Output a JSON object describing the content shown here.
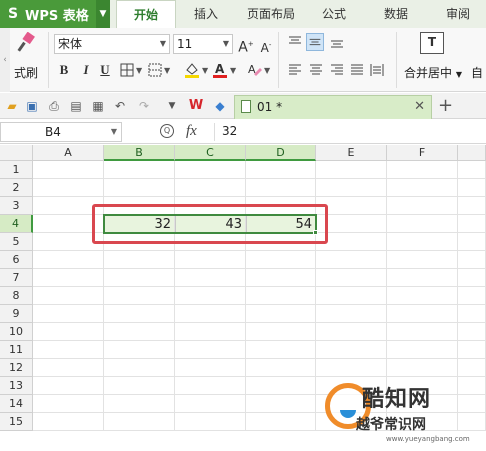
{
  "app": {
    "name": "WPS 表格"
  },
  "menu_tabs": [
    "开始",
    "插入",
    "页面布局",
    "公式",
    "数据",
    "审阅"
  ],
  "ribbon": {
    "format_painter_label": "式刷",
    "font_name": "宋体",
    "font_size": "11",
    "grow_font": "A",
    "shrink_font": "A",
    "bold": "B",
    "italic": "I",
    "underline": "U",
    "merge_center_label": "合并居中",
    "auto_label": "自"
  },
  "document": {
    "tab_name": "01 *"
  },
  "formula_bar": {
    "cell_ref": "B4",
    "fx_label": "fx",
    "value": "32"
  },
  "sheet": {
    "columns": [
      "A",
      "B",
      "C",
      "D",
      "E",
      "F"
    ],
    "rows": [
      "1",
      "2",
      "3",
      "4",
      "5",
      "6",
      "7",
      "8",
      "9",
      "10",
      "11",
      "12",
      "13",
      "14",
      "15"
    ],
    "cells": {
      "B4": "32",
      "C4": "43",
      "D4": "54"
    },
    "selected_range": "B4:D4"
  },
  "watermark": {
    "title": "酷知网",
    "subtitle": "越爷常识网",
    "url": "www.yueyangbang.com"
  },
  "colors": {
    "accent": "#4a9a3a",
    "selection": "#3f8a3f",
    "annotation": "#d9474f"
  }
}
